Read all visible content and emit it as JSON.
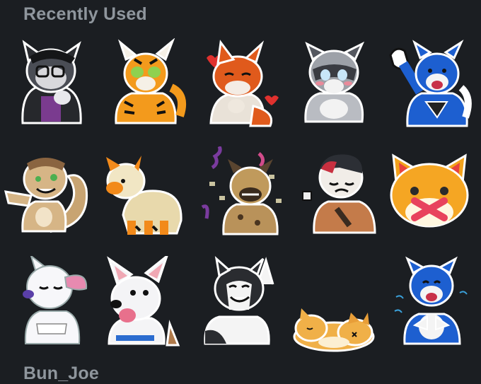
{
  "sections": [
    {
      "title": "Recently Used"
    },
    {
      "title": "Bun_Joe"
    }
  ],
  "stickers": [
    {
      "name": "sticker-dark-cat-glasses"
    },
    {
      "name": "sticker-tiger-shrug"
    },
    {
      "name": "sticker-fox-hearts"
    },
    {
      "name": "sticker-raccoon-blush"
    },
    {
      "name": "sticker-blue-dog-wave"
    },
    {
      "name": "sticker-squirrel-point"
    },
    {
      "name": "sticker-arcanine-walk"
    },
    {
      "name": "sticker-hyena-confetti"
    },
    {
      "name": "sticker-red-hair-wolf-cry"
    },
    {
      "name": "sticker-fox-face-sealed"
    },
    {
      "name": "sticker-white-cat-sleepy"
    },
    {
      "name": "sticker-white-dog-yell"
    },
    {
      "name": "sticker-husky-laugh"
    },
    {
      "name": "sticker-shiba-sleep"
    },
    {
      "name": "sticker-blue-dog-clap"
    }
  ],
  "colors": {
    "background": "#1b1e22",
    "section_title": "#8f969d"
  }
}
